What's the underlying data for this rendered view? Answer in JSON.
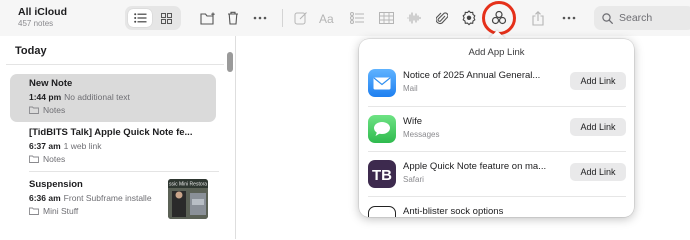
{
  "account": {
    "title": "All iCloud",
    "count": "457 notes"
  },
  "toolbar": {
    "search_placeholder": "Search",
    "highlight_color": "#e5301a"
  },
  "sidebar": {
    "section_title": "Today",
    "notes": [
      {
        "title": "New Note",
        "time": "1:44 pm",
        "snippet": "No additional text",
        "folder": "Notes"
      },
      {
        "title": "[TidBITS Talk] Apple Quick Note fe...",
        "time": "6:37 am",
        "snippet": "1 web link",
        "folder": "Notes"
      },
      {
        "title": "Suspension",
        "time": "6:36 am",
        "snippet": "Front Subframe installe",
        "folder": "Mini Stuff"
      }
    ],
    "thumb_caption": "ssic Mini Restora"
  },
  "popover": {
    "title": "Add App Link",
    "items": [
      {
        "title": "Notice of 2025 Annual General...",
        "app": "Mail",
        "button": "Add Link",
        "icon": "mail-icon",
        "color": "#2f8ff0"
      },
      {
        "title": "Wife",
        "app": "Messages",
        "button": "Add Link",
        "icon": "messages-icon",
        "color": "#34c759"
      },
      {
        "title": "Apple Quick Note feature on ma...",
        "app": "Safari",
        "button": "Add Link",
        "icon": "tidbits-icon",
        "color": "#3d2a4e"
      }
    ],
    "partial_item": "Anti-blister sock options"
  }
}
